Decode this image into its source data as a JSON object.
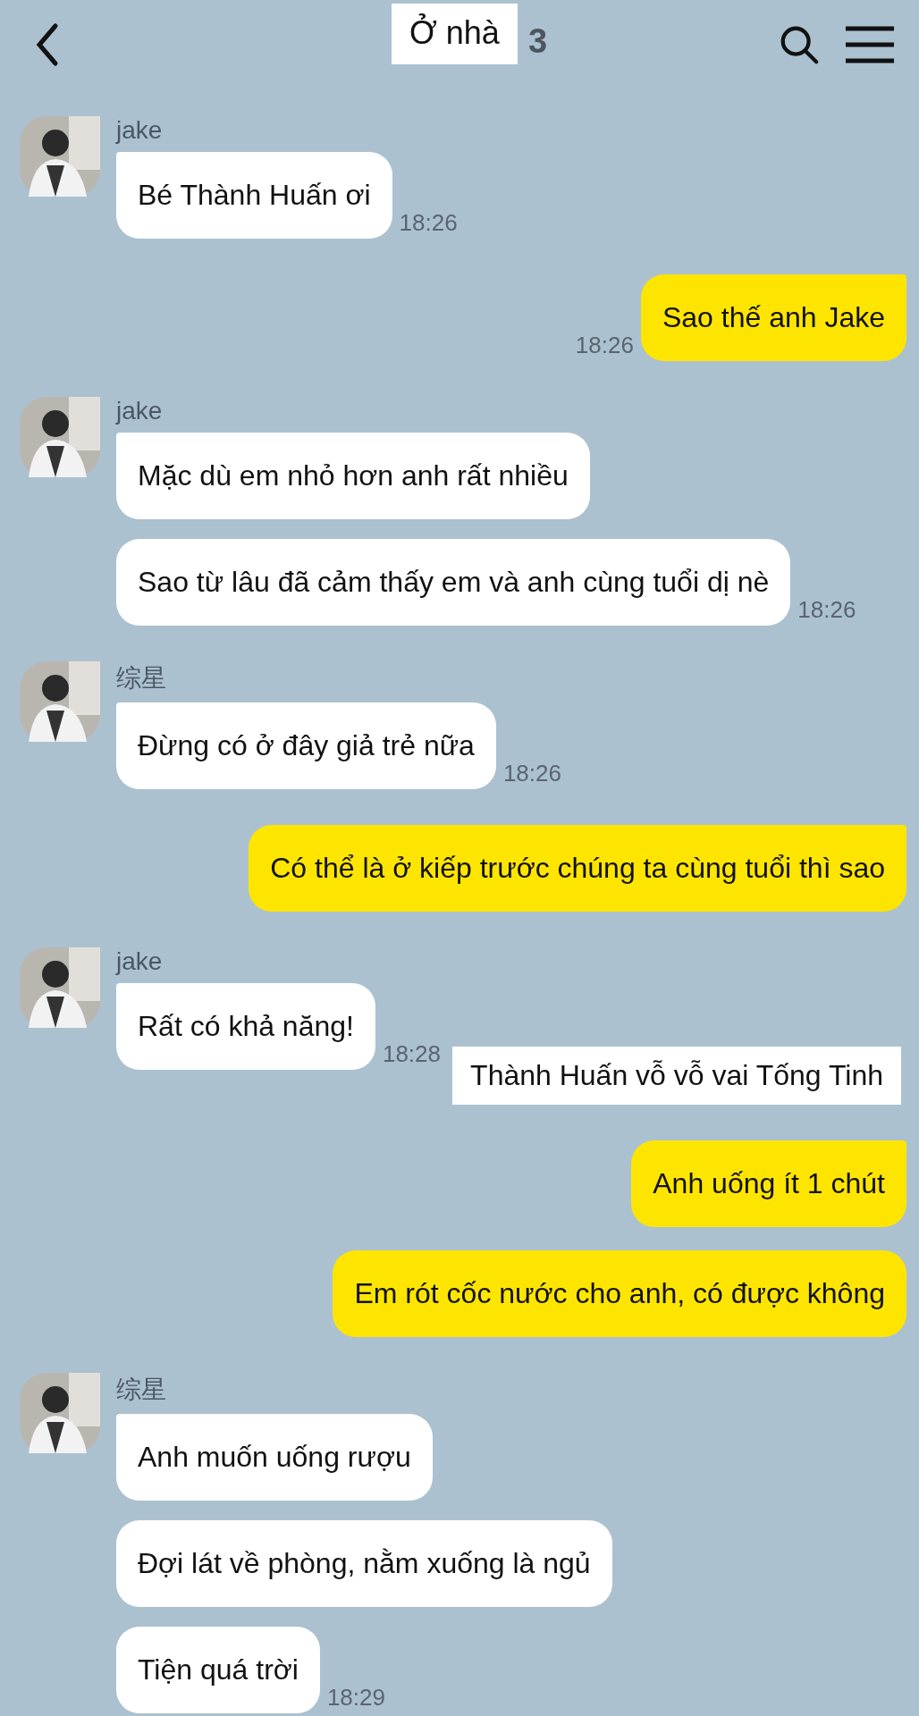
{
  "header": {
    "title": "Ở nhà",
    "member_count": "3"
  },
  "messages": [
    {
      "kind": "incoming",
      "sender": "jake",
      "bubbles": [
        "Bé Thành Huấn ơi"
      ],
      "time": "18:26"
    },
    {
      "kind": "outgoing",
      "bubbles": [
        "Sao thế anh Jake"
      ],
      "time": "18:26"
    },
    {
      "kind": "incoming",
      "sender": "jake",
      "bubbles": [
        "Mặc dù em nhỏ hơn anh rất nhiều",
        "Sao từ lâu đã cảm thấy em và anh cùng tuổi dị nè"
      ],
      "time": "18:26"
    },
    {
      "kind": "incoming",
      "sender": "综星",
      "bubbles": [
        "Đừng có ở đây giả trẻ nữa"
      ],
      "time": "18:26"
    },
    {
      "kind": "outgoing",
      "bubbles": [
        "Có thể là ở kiếp trước chúng ta cùng tuổi thì sao"
      ]
    },
    {
      "kind": "incoming",
      "sender": "jake",
      "bubbles": [
        "Rất có khả năng!"
      ],
      "time": "18:28"
    },
    {
      "kind": "narration",
      "text": "Thành Huấn vỗ vỗ vai Tống Tinh"
    },
    {
      "kind": "outgoing",
      "bubbles": [
        "Anh uống ít 1 chút",
        "Em rót cốc nước cho anh, có được không"
      ]
    },
    {
      "kind": "incoming",
      "sender": "综星",
      "bubbles": [
        "Anh muốn uống rượu",
        "Đợi lát về phòng, nằm xuống là ngủ",
        "Tiện quá trời"
      ],
      "time": "18:29"
    }
  ]
}
